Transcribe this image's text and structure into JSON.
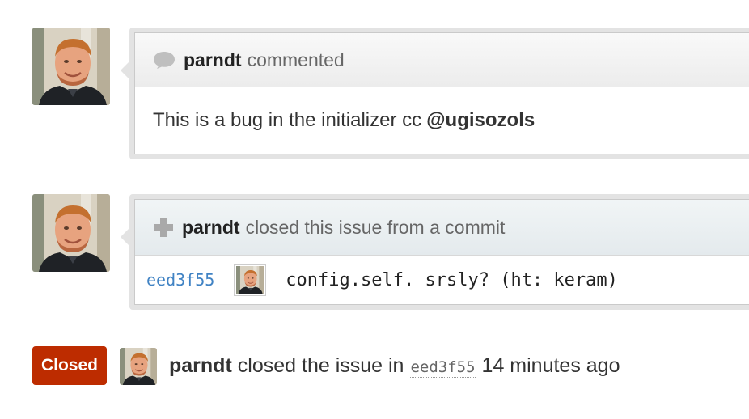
{
  "timeline": {
    "comment": {
      "author": "parndt",
      "action": "commented",
      "body_text": "This is a bug in the initializer cc",
      "mention": "@ugisozols"
    },
    "close_event": {
      "author": "parndt",
      "action": "closed this issue from a commit",
      "commit": {
        "sha": "eed3f55",
        "message": "config.self. srsly? (ht: keram)"
      }
    },
    "closed_event": {
      "badge": "Closed",
      "author": "parndt",
      "text_before": "closed the issue in",
      "sha": "eed3f55",
      "time": "14 minutes ago"
    }
  },
  "icons": {
    "comment": "speech-bubble-icon",
    "close": "plus-icon"
  },
  "colors": {
    "closed_badge": "#bd2c00",
    "link": "#4183c4"
  }
}
